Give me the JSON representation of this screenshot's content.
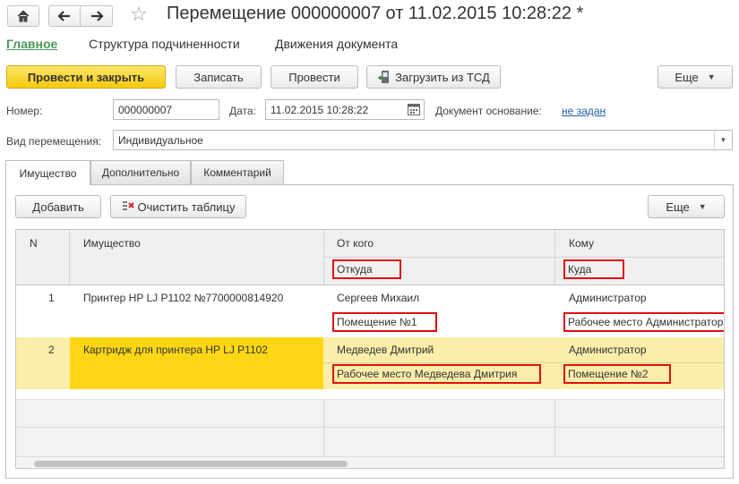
{
  "window": {
    "title": "Перемещение 000000007 от 11.02.2015 10:28:22 *"
  },
  "sections": [
    "Главное",
    "Структура подчиненности",
    "Движения документа"
  ],
  "toolbar": {
    "post_and_close": "Провести и закрыть",
    "save": "Записать",
    "post": "Провести",
    "load_tsd": "Загрузить из ТСД",
    "more": "Еще"
  },
  "form": {
    "number_label": "Номер:",
    "number_value": "000000007",
    "date_label": "Дата:",
    "date_value": "11.02.2015 10:28:22",
    "basis_label": "Документ основание:",
    "basis_value": "не задан",
    "kind_label": "Вид перемещения:",
    "kind_value": "Индивидуальное"
  },
  "tabs": [
    "Имущество",
    "Дополнительно",
    "Комментарий"
  ],
  "table_toolbar": {
    "add": "Добавить",
    "clear": "Очистить таблицу",
    "more": "Еще"
  },
  "table": {
    "headers": {
      "n": "N",
      "item": "Имущество",
      "from": "От кого",
      "from_sub": "Откуда",
      "to": "Кому",
      "to_sub": "Куда"
    },
    "rows": [
      {
        "n": "1",
        "item": "Принтер HP LJ P1102 №7700000814920",
        "from": "Сергеев Михаил",
        "from_place": "Помещение №1",
        "to": "Администратор",
        "to_place": "Рабочее место Администратора"
      },
      {
        "n": "2",
        "item": "Картридж для принтера HP LJ P1102",
        "from": "Медведев Дмитрий",
        "from_place": "Рабочее место Медведева Дмитрия",
        "to": "Администратор",
        "to_place": "Помещение №2"
      }
    ]
  },
  "colors": {
    "primary_button": "#f5c90c",
    "active_section": "#4a9a55",
    "selected_row": "#fbeeaa",
    "selected_cell": "#fdd716",
    "highlight_box": "#e01010",
    "link": "#1f5fae"
  }
}
